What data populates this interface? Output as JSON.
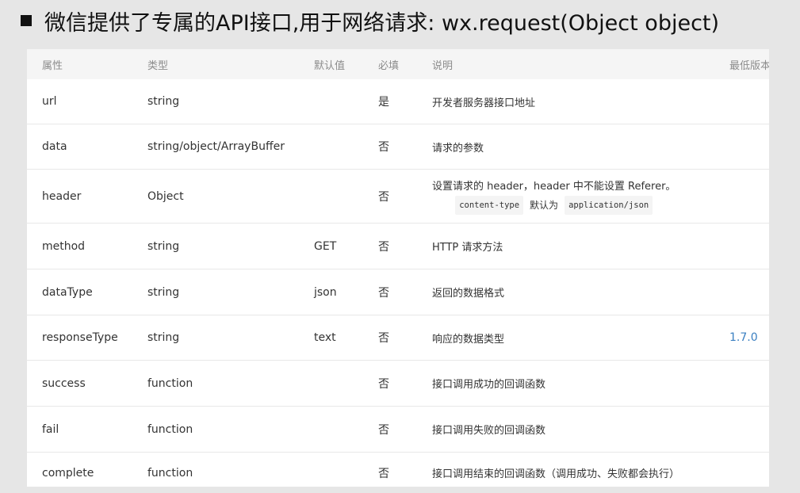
{
  "slide": {
    "title": "微信提供了专属的API接口,用于网络请求: wx.request(Object object)"
  },
  "table": {
    "headers": [
      "属性",
      "类型",
      "默认值",
      "必填",
      "说明",
      "最低版本"
    ],
    "rows": [
      {
        "name": "url",
        "type": "string",
        "default": "",
        "required": "是",
        "desc": "开发者服务器接口地址",
        "version": ""
      },
      {
        "name": "data",
        "type": "string/object/ArrayBuffer",
        "default": "",
        "required": "否",
        "desc": "请求的参数",
        "version": ""
      },
      {
        "name": "header",
        "type": "Object",
        "default": "",
        "required": "否",
        "desc": "设置请求的 header，header 中不能设置 Referer。",
        "desc_code1": "content-type",
        "desc_mid": "默认为",
        "desc_code2": "application/json",
        "version": ""
      },
      {
        "name": "method",
        "type": "string",
        "default": "GET",
        "required": "否",
        "desc": "HTTP 请求方法",
        "version": ""
      },
      {
        "name": "dataType",
        "type": "string",
        "default": "json",
        "required": "否",
        "desc": "返回的数据格式",
        "version": ""
      },
      {
        "name": "responseType",
        "type": "string",
        "default": "text",
        "required": "否",
        "desc": "响应的数据类型",
        "version": "1.7.0"
      },
      {
        "name": "success",
        "type": "function",
        "default": "",
        "required": "否",
        "desc": "接口调用成功的回调函数",
        "version": ""
      },
      {
        "name": "fail",
        "type": "function",
        "default": "",
        "required": "否",
        "desc": "接口调用失败的回调函数",
        "version": ""
      },
      {
        "name": "complete",
        "type": "function",
        "default": "",
        "required": "否",
        "desc": "接口调用结束的回调函数（调用成功、失败都会执行）",
        "version": ""
      }
    ]
  }
}
